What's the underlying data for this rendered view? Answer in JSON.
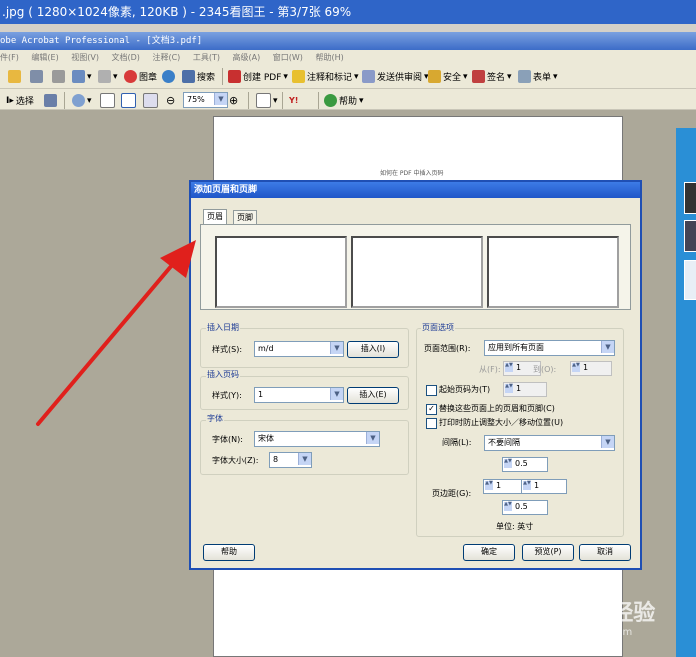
{
  "outer_window": {
    "title": ".jpg ( 1280×1024像素, 120KB ) - 2345看图王 - 第3/7张 69%"
  },
  "acrobat": {
    "title": "obe Acrobat Professional - [文档3.pdf]",
    "menu": [
      "件(F)",
      "编辑(E)",
      "视图(V)",
      "文档(D)",
      "注释(C)",
      "工具(T)",
      "高级(A)",
      "窗口(W)",
      "帮助(H)"
    ],
    "toolbar1": {
      "stamp": "图章",
      "search": "搜索",
      "create_pdf": "创建 PDF",
      "comment": "注释和标记",
      "send_review": "发送供审阅",
      "security": "安全",
      "sign": "签名",
      "forms": "表单"
    },
    "toolbar2": {
      "select": "选择",
      "zoom": "75%",
      "help": "帮助"
    },
    "page_text": "如何在 PDF 中插入页码"
  },
  "dialog": {
    "title": "添加页眉和页脚",
    "tabs": [
      "页眉",
      "页脚"
    ],
    "insert_date": {
      "group_label": "插入日期",
      "style_label": "样式(S):",
      "style_value": "m/d",
      "insert_button": "插入(I)"
    },
    "insert_page": {
      "group_label": "插入页码",
      "style_label": "样式(Y):",
      "style_value": "1",
      "insert_button": "插入(E)"
    },
    "font": {
      "group_label": "字体",
      "font_label": "字体(N):",
      "font_value": "宋体",
      "size_label": "字体大小(Z):",
      "size_value": "8"
    },
    "page_options": {
      "group_label": "页面选项",
      "range_label": "页面范围(R):",
      "range_value": "应用到所有页面",
      "from_label": "从(F):",
      "from_value": "1",
      "to_label": "到(O):",
      "to_value": "1",
      "start_page_label": "起始页码为(T)",
      "start_page_value": "1",
      "replace_label": "替换这些页面上的页眉和页脚(C)",
      "replace_checked": true,
      "shrink_label": "打印时防止调整大小／移动位置(U)",
      "shrink_checked": false,
      "gap_label": "间隔(L):",
      "gap_value": "不要间隔",
      "margin_label": "页边距(G):",
      "margin_top": "0.5",
      "margin_left": "1",
      "margin_right": "1",
      "margin_bottom": "0.5",
      "unit_label": "单位: 英寸"
    },
    "buttons": {
      "help": "帮助",
      "ok": "确定",
      "preview": "预览(P)",
      "cancel": "取消"
    }
  },
  "watermark": {
    "brand": "Baidu 经验",
    "url": "jingyan.baidu.com"
  },
  "colors": {
    "title_blue": "#2f65c8",
    "dialog_border": "#1f4fb4",
    "arrow_red": "#e0201c",
    "panel_blue": "#2a8fd6"
  }
}
